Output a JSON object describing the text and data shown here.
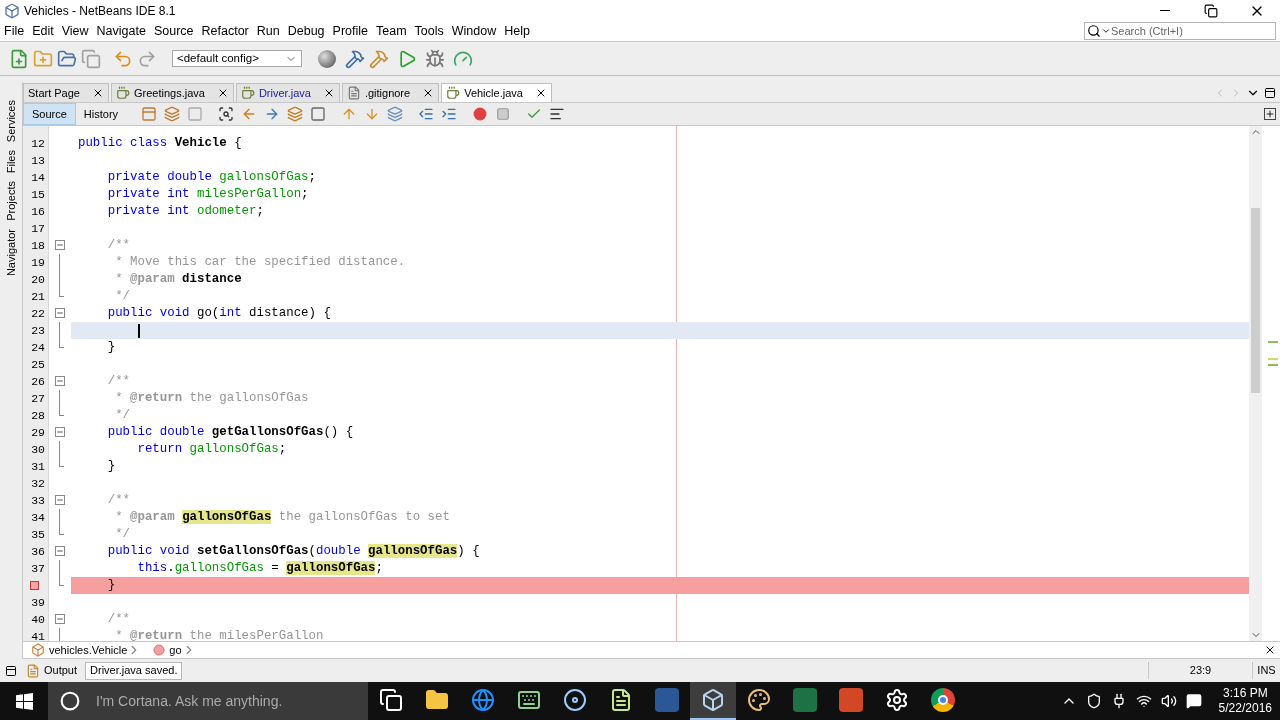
{
  "window": {
    "title": "Vehicles - NetBeans IDE 8.1"
  },
  "menu": [
    "File",
    "Edit",
    "View",
    "Navigate",
    "Source",
    "Refactor",
    "Run",
    "Debug",
    "Profile",
    "Team",
    "Tools",
    "Window",
    "Help"
  ],
  "search": {
    "placeholder": "Search (Ctrl+I)"
  },
  "toolbar": {
    "config": "<default config>"
  },
  "side_panels": [
    "Services",
    "Files",
    "Projects",
    "Navigator"
  ],
  "editor_tabs": [
    {
      "label": "Start Page",
      "selected": false,
      "emphasized": false,
      "kind": "page"
    },
    {
      "label": "Greetings.java",
      "selected": false,
      "emphasized": false,
      "kind": "java"
    },
    {
      "label": "Driver.java",
      "selected": false,
      "emphasized": true,
      "kind": "java"
    },
    {
      "label": ".gitignore",
      "selected": false,
      "emphasized": false,
      "kind": "file"
    },
    {
      "label": "Vehicle.java",
      "selected": true,
      "emphasized": false,
      "kind": "java"
    }
  ],
  "view_tabs": [
    {
      "label": "Source",
      "selected": true
    },
    {
      "label": "History",
      "selected": false
    }
  ],
  "code_lines": [
    {
      "number": "12",
      "kind": "plain",
      "current": false,
      "breakpoint": false,
      "tokens": [
        {
          "kind": "kw",
          "text": "public class"
        },
        {
          "kind": "name",
          "text": " Vehicle"
        },
        {
          "kind": "plain",
          "text": " {"
        }
      ]
    },
    {
      "number": "13",
      "kind": "plain",
      "current": false,
      "breakpoint": false
    },
    {
      "number": "14",
      "kind": "plain",
      "current": false,
      "breakpoint": false,
      "tokens": [
        {
          "kind": "kw",
          "text": "    private double"
        },
        {
          "kind": "field",
          "text": " gallonsOfGas"
        },
        {
          "kind": "plain",
          "text": ";"
        }
      ]
    },
    {
      "number": "15",
      "kind": "plain",
      "current": false,
      "breakpoint": false,
      "tokens": [
        {
          "kind": "kw",
          "text": "    private int"
        },
        {
          "kind": "field",
          "text": " milesPerGallon"
        },
        {
          "kind": "plain",
          "text": ";"
        }
      ]
    },
    {
      "number": "16",
      "kind": "plain",
      "current": false,
      "breakpoint": false,
      "tokens": [
        {
          "kind": "kw",
          "text": "    private int"
        },
        {
          "kind": "field",
          "text": " odometer"
        },
        {
          "kind": "plain",
          "text": ";"
        }
      ]
    },
    {
      "number": "17",
      "kind": "plain",
      "current": false,
      "breakpoint": false
    },
    {
      "number": "18",
      "kind": "fold-start",
      "current": false,
      "breakpoint": false,
      "tokens": [
        {
          "kind": "comment",
          "text": "    /**"
        }
      ]
    },
    {
      "number": "19",
      "kind": "fold-body",
      "current": false,
      "breakpoint": false,
      "tokens": [
        {
          "kind": "comment",
          "text": "     * Move this car the specified distance."
        }
      ]
    },
    {
      "number": "20",
      "kind": "fold-body",
      "current": false,
      "breakpoint": false,
      "tokens": [
        {
          "kind": "comment",
          "text": "     *"
        },
        {
          "kind": "tag",
          "text": " @param"
        },
        {
          "kind": "ref",
          "text": " distance"
        }
      ]
    },
    {
      "number": "21",
      "kind": "fold-end",
      "current": false,
      "breakpoint": false,
      "tokens": [
        {
          "kind": "comment",
          "text": "     */"
        }
      ]
    },
    {
      "number": "22",
      "kind": "fold-start",
      "current": false,
      "breakpoint": false,
      "tokens": [
        {
          "kind": "kw",
          "text": "    public void"
        },
        {
          "kind": "plain",
          "text": " go("
        },
        {
          "kind": "kw",
          "text": "int"
        },
        {
          "kind": "plain",
          "text": " distance) {"
        }
      ]
    },
    {
      "number": "23",
      "kind": "fold-body",
      "current": true,
      "breakpoint": false
    },
    {
      "number": "24",
      "kind": "fold-end",
      "current": false,
      "breakpoint": false,
      "tokens": [
        {
          "kind": "plain",
          "text": "    }"
        }
      ]
    },
    {
      "number": "25",
      "kind": "plain",
      "current": false,
      "breakpoint": false
    },
    {
      "number": "26",
      "kind": "fold-start",
      "current": false,
      "breakpoint": false,
      "tokens": [
        {
          "kind": "comment",
          "text": "    /**"
        }
      ]
    },
    {
      "number": "27",
      "kind": "fold-body",
      "current": false,
      "breakpoint": false,
      "tokens": [
        {
          "kind": "comment",
          "text": "     *"
        },
        {
          "kind": "tag",
          "text": " @return"
        },
        {
          "kind": "comment",
          "text": " the gallonsOfGas"
        }
      ]
    },
    {
      "number": "28",
      "kind": "fold-end",
      "current": false,
      "breakpoint": false,
      "tokens": [
        {
          "kind": "comment",
          "text": "     */"
        }
      ]
    },
    {
      "number": "29",
      "kind": "fold-start",
      "current": false,
      "breakpoint": false,
      "tokens": [
        {
          "kind": "kw",
          "text": "    public double"
        },
        {
          "kind": "name",
          "text": " getGallonsOfGas"
        },
        {
          "kind": "plain",
          "text": "() {"
        }
      ]
    },
    {
      "number": "30",
      "kind": "fold-body",
      "current": false,
      "breakpoint": false,
      "tokens": [
        {
          "kind": "kw",
          "text": "        return"
        },
        {
          "kind": "field",
          "text": " gallonsOfGas"
        },
        {
          "kind": "plain",
          "text": ";"
        }
      ]
    },
    {
      "number": "31",
      "kind": "fold-end",
      "current": false,
      "breakpoint": false,
      "tokens": [
        {
          "kind": "plain",
          "text": "    }"
        }
      ]
    },
    {
      "number": "32",
      "kind": "plain",
      "current": false,
      "breakpoint": false
    },
    {
      "number": "33",
      "kind": "fold-start",
      "current": false,
      "breakpoint": false,
      "tokens": [
        {
          "kind": "comment",
          "text": "    /**"
        }
      ]
    },
    {
      "number": "34",
      "kind": "fold-body",
      "current": false,
      "breakpoint": false,
      "tokens": [
        {
          "kind": "comment",
          "text": "     *"
        },
        {
          "kind": "tag",
          "text": " @param "
        },
        {
          "kind": "occurrence",
          "text": "gallonsOfGas"
        },
        {
          "kind": "comment",
          "text": " the gallonsOfGas to set"
        }
      ]
    },
    {
      "number": "35",
      "kind": "fold-end",
      "current": false,
      "breakpoint": false,
      "tokens": [
        {
          "kind": "comment",
          "text": "     */"
        }
      ]
    },
    {
      "number": "36",
      "kind": "fold-start",
      "current": false,
      "breakpoint": false,
      "tokens": [
        {
          "kind": "kw",
          "text": "    public void"
        },
        {
          "kind": "name",
          "text": " setGallonsOfGas"
        },
        {
          "kind": "plain",
          "text": "("
        },
        {
          "kind": "kw",
          "text": "double "
        },
        {
          "kind": "occurrence",
          "text": "gallonsOfGas"
        },
        {
          "kind": "plain",
          "text": ") {"
        }
      ]
    },
    {
      "number": "37",
      "kind": "fold-body",
      "current": false,
      "breakpoint": false,
      "tokens": [
        {
          "kind": "kw",
          "text": "        this"
        },
        {
          "kind": "plain",
          "text": "."
        },
        {
          "kind": "field",
          "text": "gallonsOfGas"
        },
        {
          "kind": "plain",
          "text": " = "
        },
        {
          "kind": "occurrence",
          "text": "gallonsOfGas"
        },
        {
          "kind": "plain",
          "text": ";"
        }
      ]
    },
    {
      "kind": "fold-end",
      "current": false,
      "breakpoint": true,
      "tokens": [
        {
          "kind": "plain",
          "text": "    }"
        }
      ]
    },
    {
      "number": "39",
      "kind": "plain",
      "current": false,
      "breakpoint": false
    },
    {
      "number": "40",
      "kind": "fold-start",
      "current": false,
      "breakpoint": false,
      "tokens": [
        {
          "kind": "comment",
          "text": "    /**"
        }
      ]
    },
    {
      "number": "41",
      "kind": "fold-body",
      "current": false,
      "breakpoint": false,
      "tokens": [
        {
          "kind": "comment",
          "text": "     *"
        },
        {
          "kind": "tag",
          "text": " @return"
        },
        {
          "kind": "comment",
          "text": " the milesPerGallon"
        }
      ]
    }
  ],
  "breadcrumbs": [
    {
      "label": "vehicles.Vehicle",
      "kind": "class"
    },
    {
      "label": "go",
      "kind": "method"
    }
  ],
  "status_bar": {
    "output_tab": "Output",
    "message": "Driver.java saved.",
    "position": "23:9",
    "mode": "INS"
  },
  "taskbar": {
    "search_placeholder": "I'm Cortana. Ask me anything.",
    "apps": [
      {
        "kind": "task-view",
        "active": false
      },
      {
        "kind": "folder",
        "active": false
      },
      {
        "kind": "browser",
        "active": false
      },
      {
        "kind": "keyboard",
        "active": false
      },
      {
        "kind": "media",
        "active": false
      },
      {
        "kind": "notepad",
        "active": false
      },
      {
        "kind": "word",
        "active": false
      },
      {
        "kind": "cube",
        "active": true
      },
      {
        "kind": "paint",
        "active": false
      },
      {
        "kind": "excel",
        "active": false
      },
      {
        "kind": "slides",
        "active": false
      },
      {
        "kind": "settings",
        "active": false
      },
      {
        "kind": "chrome",
        "active": false
      }
    ],
    "time": "3:16 PM",
    "date": "5/22/2016"
  }
}
